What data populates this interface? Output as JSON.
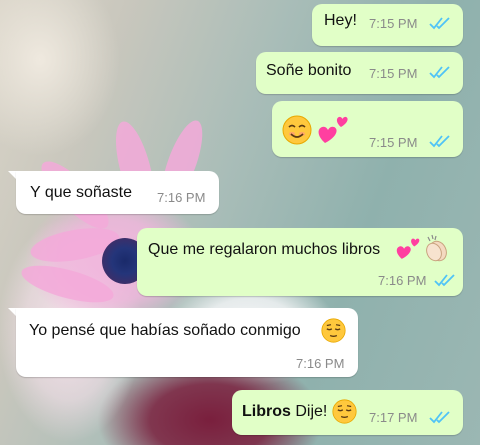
{
  "chat": {
    "messages": [
      {
        "id": "m1",
        "direction": "outgoing",
        "text": "Hey!",
        "time": "7:15 PM",
        "status": "read",
        "tick_color": "#4fc3f7"
      },
      {
        "id": "m2",
        "direction": "outgoing",
        "text": "Soñe bonito",
        "time": "7:15 PM",
        "status": "read",
        "tick_color": "#4fc3f7"
      },
      {
        "id": "m3",
        "direction": "outgoing",
        "text": "",
        "emojis": [
          "smiling-face-icon",
          "two-hearts-icon"
        ],
        "time": "7:15 PM",
        "status": "read",
        "tick_color": "#4fc3f7"
      },
      {
        "id": "m4",
        "direction": "incoming",
        "text": "Y que soñaste",
        "time": "7:16 PM"
      },
      {
        "id": "m5",
        "direction": "outgoing",
        "text": "Que me regalaron muchos libros",
        "emojis": [
          "two-hearts-icon",
          "clapping-hands-icon"
        ],
        "time": "7:16 PM",
        "status": "read",
        "tick_color": "#4fc3f7"
      },
      {
        "id": "m6",
        "direction": "incoming",
        "text": "Yo pensé que habías soñado conmigo",
        "emojis": [
          "relieved-face-icon"
        ],
        "time": "7:16 PM"
      },
      {
        "id": "m7",
        "direction": "outgoing",
        "bold_text": "Libros",
        "text": " Dije!",
        "emojis": [
          "relieved-face-icon"
        ],
        "time": "7:17 PM",
        "status": "read",
        "tick_color": "#4fc3f7"
      }
    ]
  },
  "colors": {
    "outgoing_bubble": "#e1ffc7",
    "incoming_bubble": "#ffffff",
    "read_ticks": "#4fc3f7",
    "timestamp": "#8a8a8a"
  }
}
